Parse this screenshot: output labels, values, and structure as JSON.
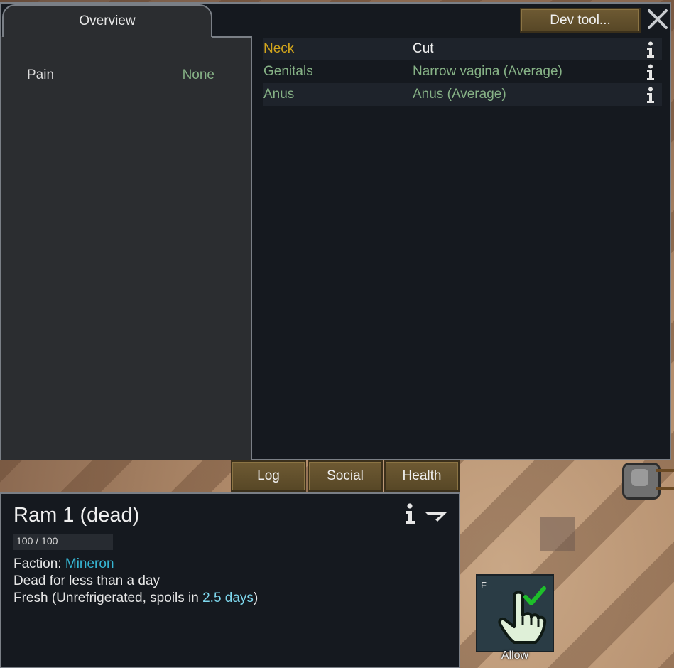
{
  "health_window": {
    "overview_tab": "Overview",
    "dev_tool_button": "Dev tool...",
    "stats": [
      {
        "label": "Pain",
        "value": "None"
      }
    ],
    "parts": [
      {
        "part": "Neck",
        "condition": "Cut",
        "part_color": "#d2a51c",
        "condition_color": "#f0f0f0"
      },
      {
        "part": "Genitals",
        "condition": "Narrow vagina (Average)",
        "part_color": "#86b286",
        "condition_color": "#86b286"
      },
      {
        "part": "Anus",
        "condition": "Anus (Average)",
        "part_color": "#86b286",
        "condition_color": "#86b286"
      }
    ]
  },
  "inspect_tabs": [
    "Log",
    "Social",
    "Health"
  ],
  "inspect": {
    "title": "Ram 1 (dead)",
    "hp": {
      "current": "100",
      "sep": " / ",
      "max": "100",
      "text": "100 / 100",
      "fraction": 1.0
    },
    "faction_label": "Faction: ",
    "faction_name": "Mineron",
    "status_line": "Dead for less than a day",
    "fresh_prefix": "Fresh (Unrefrigerated, spoils in ",
    "spoil_time": "2.5 days",
    "fresh_suffix": ")"
  },
  "gizmo": {
    "hotkey": "F",
    "label": "Allow",
    "icon": "hand-pointer-check-icon"
  },
  "colors": {
    "window_bg": "#15191f",
    "panel_bg": "#2b2d30",
    "button_brown": "#6e5a33",
    "healthy_green": "#86b286",
    "injury_orange": "#d2a51c",
    "faction_cyan": "#36b5d2"
  }
}
